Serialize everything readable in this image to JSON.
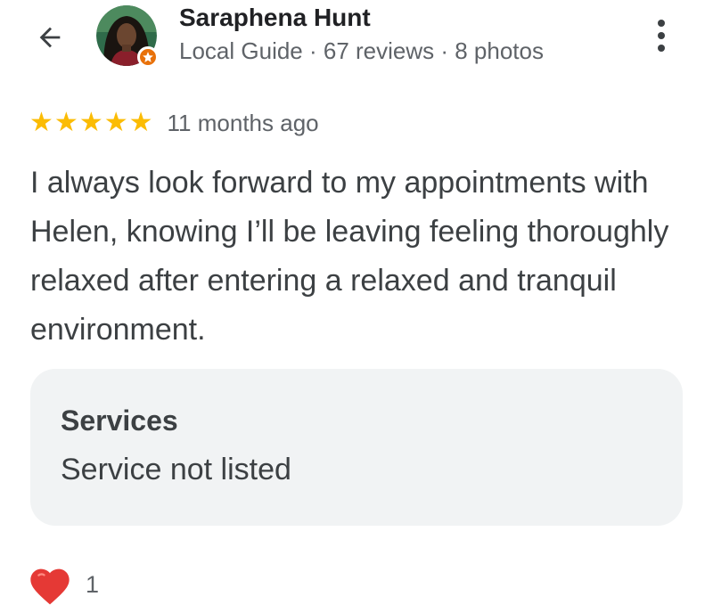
{
  "reviewer": {
    "name": "Saraphena Hunt",
    "meta": "Local Guide · 67 reviews · 8 photos",
    "badge_color": "#e8710a"
  },
  "review": {
    "rating": 5,
    "rating_max": 5,
    "stars": [
      "★",
      "★",
      "★",
      "★",
      "★"
    ],
    "time": "11 months ago",
    "text": "I always look forward to my appointments with Helen, knowing I’ll be leaving feeling thoroughly relaxed after entering a relaxed and tranquil environment."
  },
  "services": {
    "title": "Services",
    "value": "Service not listed"
  },
  "reactions": {
    "icon": "heart-icon",
    "count": "1"
  },
  "icons": {
    "back": "back-arrow-icon",
    "more": "more-vert-icon",
    "star": "star-icon"
  },
  "colors": {
    "star": "#fbbc04",
    "card_bg": "#f1f3f4",
    "heart": "#e53935"
  }
}
